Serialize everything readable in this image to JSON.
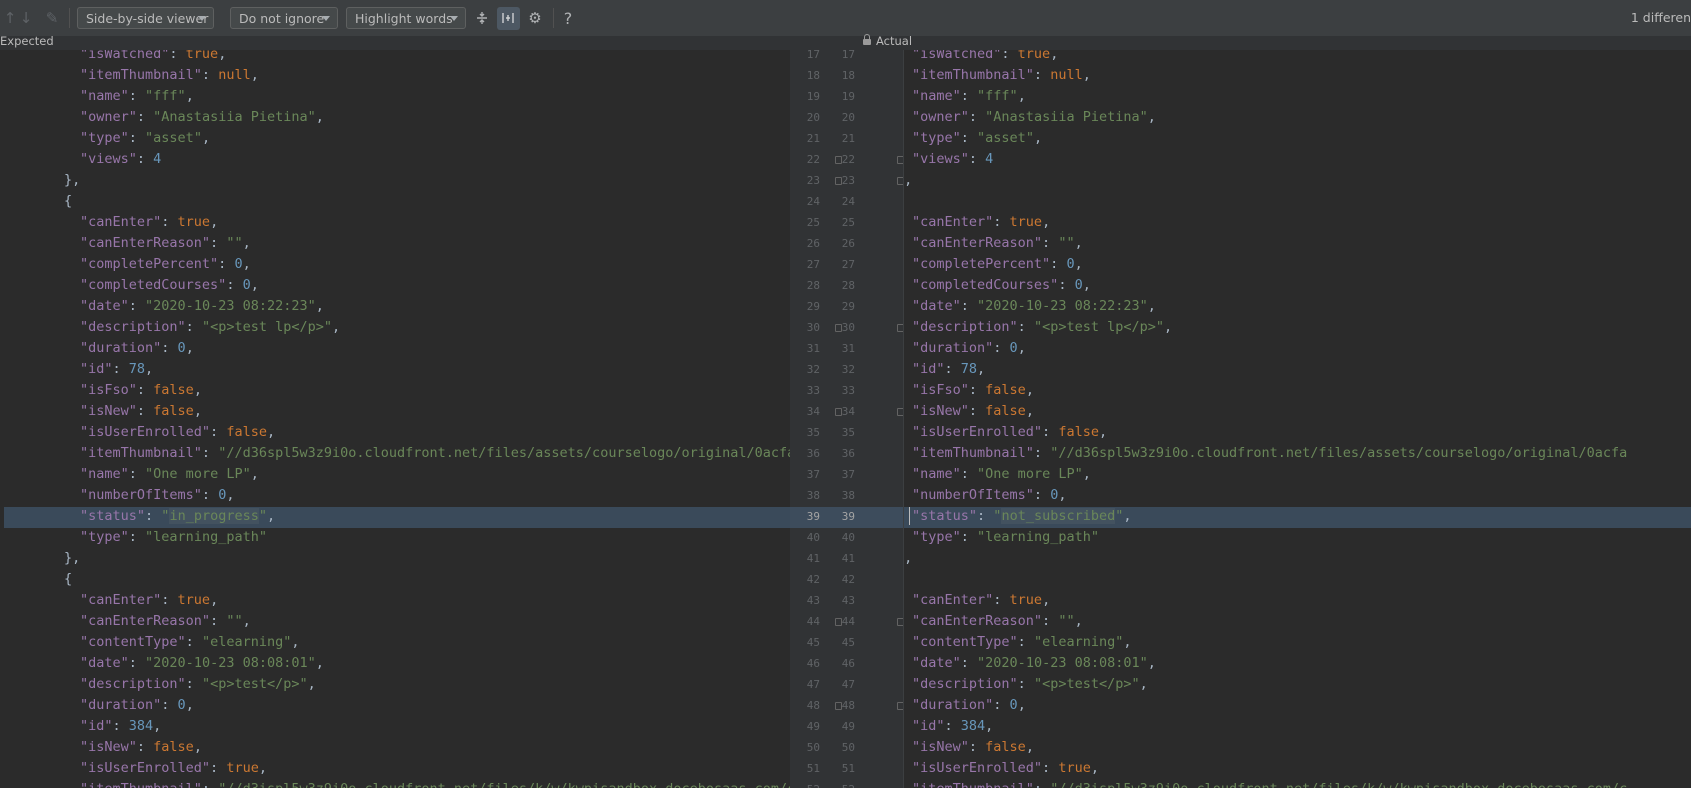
{
  "toolbar": {
    "viewer_select": "Side-by-side viewer",
    "ignore_select": "Do not ignore",
    "highlight_select": "Highlight words",
    "icons": [
      "arrow-up-icon",
      "arrow-down-icon",
      "edit-icon",
      "collapse-unchanged-icon",
      "sync-scroll-icon",
      "settings-icon",
      "help-icon"
    ],
    "help_glyph": "?",
    "differences_text": "1 differen"
  },
  "panes": {
    "left_title": "Expected",
    "right_title": "Actual"
  },
  "colors": {
    "key": "#9876aa",
    "string": "#6a8759",
    "number": "#6897bb",
    "keyword": "#cc7832",
    "changed_line_bg": "#3a4a5a"
  },
  "line_numbers": [
    "17",
    "18",
    "19",
    "20",
    "21",
    "22",
    "23",
    "24",
    "25",
    "26",
    "27",
    "28",
    "29",
    "30",
    "31",
    "32",
    "33",
    "34",
    "35",
    "36",
    "37",
    "38",
    "39",
    "40",
    "41",
    "42",
    "43",
    "44",
    "45",
    "46",
    "47",
    "48",
    "49",
    "50",
    "51",
    "52"
  ],
  "changed_line": "39",
  "left_lines": [
    {
      "i": 2,
      "k": "\"isWatched\"",
      "v": "true",
      "t": "kw",
      "c": ","
    },
    {
      "i": 2,
      "k": "\"itemThumbnail\"",
      "v": "null",
      "t": "kw",
      "c": ","
    },
    {
      "i": 2,
      "k": "\"name\"",
      "v": "\"fff\"",
      "t": "str",
      "c": ","
    },
    {
      "i": 2,
      "k": "\"owner\"",
      "v": "\"Anastasiia Pietina\"",
      "t": "str",
      "c": ","
    },
    {
      "i": 2,
      "k": "\"type\"",
      "v": "\"asset\"",
      "t": "str",
      "c": ","
    },
    {
      "i": 2,
      "k": "\"views\"",
      "v": "4",
      "t": "num",
      "c": ""
    },
    {
      "i": 1,
      "p": "},"
    },
    {
      "i": 1,
      "p": "{"
    },
    {
      "i": 2,
      "k": "\"canEnter\"",
      "v": "true",
      "t": "kw",
      "c": ","
    },
    {
      "i": 2,
      "k": "\"canEnterReason\"",
      "v": "\"\"",
      "t": "str",
      "c": ","
    },
    {
      "i": 2,
      "k": "\"completePercent\"",
      "v": "0",
      "t": "num",
      "c": ","
    },
    {
      "i": 2,
      "k": "\"completedCourses\"",
      "v": "0",
      "t": "num",
      "c": ","
    },
    {
      "i": 2,
      "k": "\"date\"",
      "v": "\"2020-10-23 08:22:23\"",
      "t": "str",
      "c": ","
    },
    {
      "i": 2,
      "k": "\"description\"",
      "v": "\"<p>test lp</p>\"",
      "t": "str",
      "c": ","
    },
    {
      "i": 2,
      "k": "\"duration\"",
      "v": "0",
      "t": "num",
      "c": ","
    },
    {
      "i": 2,
      "k": "\"id\"",
      "v": "78",
      "t": "num",
      "c": ","
    },
    {
      "i": 2,
      "k": "\"isFso\"",
      "v": "false",
      "t": "kw",
      "c": ","
    },
    {
      "i": 2,
      "k": "\"isNew\"",
      "v": "false",
      "t": "kw",
      "c": ","
    },
    {
      "i": 2,
      "k": "\"isUserEnrolled\"",
      "v": "false",
      "t": "kw",
      "c": ","
    },
    {
      "i": 2,
      "k": "\"itemThumbnail\"",
      "v": "\"//d36spl5w3z9i0o.cloudfront.net/files/assets/courselogo/original/0acfa",
      "t": "str",
      "c": ""
    },
    {
      "i": 2,
      "k": "\"name\"",
      "v": "\"One more LP\"",
      "t": "str",
      "c": ","
    },
    {
      "i": 2,
      "k": "\"numberOfItems\"",
      "v": "0",
      "t": "num",
      "c": ","
    },
    {
      "i": 2,
      "k": "\"status\"",
      "v": "\"in_progress\"",
      "t": "str",
      "c": ",",
      "hl": "in_progress"
    },
    {
      "i": 2,
      "k": "\"type\"",
      "v": "\"learning_path\"",
      "t": "str",
      "c": ""
    },
    {
      "i": 1,
      "p": "},"
    },
    {
      "i": 1,
      "p": "{"
    },
    {
      "i": 2,
      "k": "\"canEnter\"",
      "v": "true",
      "t": "kw",
      "c": ","
    },
    {
      "i": 2,
      "k": "\"canEnterReason\"",
      "v": "\"\"",
      "t": "str",
      "c": ","
    },
    {
      "i": 2,
      "k": "\"contentType\"",
      "v": "\"elearning\"",
      "t": "str",
      "c": ","
    },
    {
      "i": 2,
      "k": "\"date\"",
      "v": "\"2020-10-23 08:08:01\"",
      "t": "str",
      "c": ","
    },
    {
      "i": 2,
      "k": "\"description\"",
      "v": "\"<p>test</p>\"",
      "t": "str",
      "c": ","
    },
    {
      "i": 2,
      "k": "\"duration\"",
      "v": "0",
      "t": "num",
      "c": ","
    },
    {
      "i": 2,
      "k": "\"id\"",
      "v": "384",
      "t": "num",
      "c": ","
    },
    {
      "i": 2,
      "k": "\"isNew\"",
      "v": "false",
      "t": "kw",
      "c": ","
    },
    {
      "i": 2,
      "k": "\"isUserEnrolled\"",
      "v": "true",
      "t": "kw",
      "c": ","
    },
    {
      "i": 2,
      "k": "\"itemThumbnail\"",
      "v": "\"//d3ispl5w3z9i0o.cloudfront.net/files/k/w/kwpisandbox.docebosaas.com/c",
      "t": "str",
      "c": ""
    }
  ],
  "right_lines": [
    {
      "i": 2,
      "k": "\"isWatched\"",
      "v": "true",
      "t": "kw",
      "c": ","
    },
    {
      "i": 2,
      "k": "\"itemThumbnail\"",
      "v": "null",
      "t": "kw",
      "c": ","
    },
    {
      "i": 2,
      "k": "\"name\"",
      "v": "\"fff\"",
      "t": "str",
      "c": ","
    },
    {
      "i": 2,
      "k": "\"owner\"",
      "v": "\"Anastasiia Pietina\"",
      "t": "str",
      "c": ","
    },
    {
      "i": 2,
      "k": "\"type\"",
      "v": "\"asset\"",
      "t": "str",
      "c": ","
    },
    {
      "i": 2,
      "k": "\"views\"",
      "v": "4",
      "t": "num",
      "c": ""
    },
    {
      "i": 1,
      "p": "},"
    },
    {
      "i": 1,
      "p": "{"
    },
    {
      "i": 2,
      "k": "\"canEnter\"",
      "v": "true",
      "t": "kw",
      "c": ","
    },
    {
      "i": 2,
      "k": "\"canEnterReason\"",
      "v": "\"\"",
      "t": "str",
      "c": ","
    },
    {
      "i": 2,
      "k": "\"completePercent\"",
      "v": "0",
      "t": "num",
      "c": ","
    },
    {
      "i": 2,
      "k": "\"completedCourses\"",
      "v": "0",
      "t": "num",
      "c": ","
    },
    {
      "i": 2,
      "k": "\"date\"",
      "v": "\"2020-10-23 08:22:23\"",
      "t": "str",
      "c": ","
    },
    {
      "i": 2,
      "k": "\"description\"",
      "v": "\"<p>test lp</p>\"",
      "t": "str",
      "c": ","
    },
    {
      "i": 2,
      "k": "\"duration\"",
      "v": "0",
      "t": "num",
      "c": ","
    },
    {
      "i": 2,
      "k": "\"id\"",
      "v": "78",
      "t": "num",
      "c": ","
    },
    {
      "i": 2,
      "k": "\"isFso\"",
      "v": "false",
      "t": "kw",
      "c": ","
    },
    {
      "i": 2,
      "k": "\"isNew\"",
      "v": "false",
      "t": "kw",
      "c": ","
    },
    {
      "i": 2,
      "k": "\"isUserEnrolled\"",
      "v": "false",
      "t": "kw",
      "c": ","
    },
    {
      "i": 2,
      "k": "\"itemThumbnail\"",
      "v": "\"//d36spl5w3z9i0o.cloudfront.net/files/assets/courselogo/original/0acfa",
      "t": "str",
      "c": ""
    },
    {
      "i": 2,
      "k": "\"name\"",
      "v": "\"One more LP\"",
      "t": "str",
      "c": ","
    },
    {
      "i": 2,
      "k": "\"numberOfItems\"",
      "v": "0",
      "t": "num",
      "c": ","
    },
    {
      "i": 2,
      "k": "\"status\"",
      "v": "\"not_subscribed\"",
      "t": "str",
      "c": ",",
      "hl": "not_subscribed"
    },
    {
      "i": 2,
      "k": "\"type\"",
      "v": "\"learning_path\"",
      "t": "str",
      "c": ""
    },
    {
      "i": 1,
      "p": "},"
    },
    {
      "i": 1,
      "p": "{"
    },
    {
      "i": 2,
      "k": "\"canEnter\"",
      "v": "true",
      "t": "kw",
      "c": ","
    },
    {
      "i": 2,
      "k": "\"canEnterReason\"",
      "v": "\"\"",
      "t": "str",
      "c": ","
    },
    {
      "i": 2,
      "k": "\"contentType\"",
      "v": "\"elearning\"",
      "t": "str",
      "c": ","
    },
    {
      "i": 2,
      "k": "\"date\"",
      "v": "\"2020-10-23 08:08:01\"",
      "t": "str",
      "c": ","
    },
    {
      "i": 2,
      "k": "\"description\"",
      "v": "\"<p>test</p>\"",
      "t": "str",
      "c": ","
    },
    {
      "i": 2,
      "k": "\"duration\"",
      "v": "0",
      "t": "num",
      "c": ","
    },
    {
      "i": 2,
      "k": "\"id\"",
      "v": "384",
      "t": "num",
      "c": ","
    },
    {
      "i": 2,
      "k": "\"isNew\"",
      "v": "false",
      "t": "kw",
      "c": ","
    },
    {
      "i": 2,
      "k": "\"isUserEnrolled\"",
      "v": "true",
      "t": "kw",
      "c": ","
    },
    {
      "i": 2,
      "k": "\"itemThumbnail\"",
      "v": "\"//d3ispl5w3z9i0o.cloudfront.net/files/k/w/kwpisandbox.docebosaas.com/c",
      "t": "str",
      "c": ""
    }
  ]
}
